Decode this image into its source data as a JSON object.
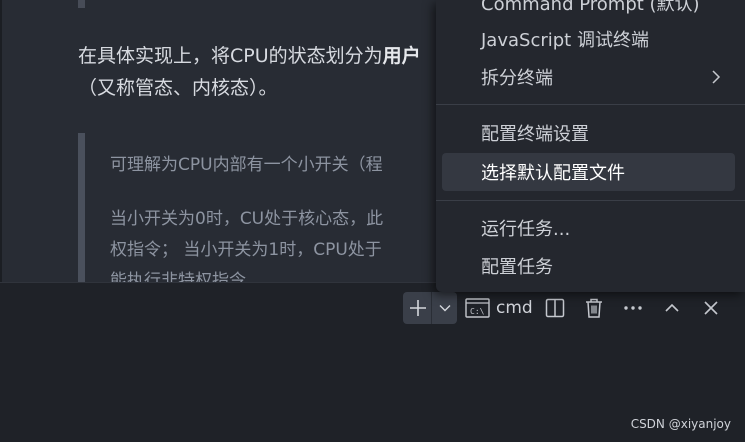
{
  "editor": {
    "para_line1_prefix": "在具体实现上，将CPU的状态划分为",
    "para_line1_bold": "用户",
    "para_line2": "（又称管态、内核态）。",
    "quote_line1": "可理解为CPU内部有一个小开关（程",
    "quote_line2": "当小开关为0时，CU处于核心态，此",
    "quote_line3": "权指令； 当小开关为1时，CPU处于",
    "quote_line4": "能执行非特权指令。"
  },
  "menu": {
    "items": [
      {
        "label": "Command Prompt (默认)"
      },
      {
        "label": "JavaScript 调试终端"
      },
      {
        "label": "拆分终端"
      },
      {
        "label": "配置终端设置"
      },
      {
        "label": "选择默认配置文件"
      },
      {
        "label": "运行任务..."
      },
      {
        "label": "配置任务"
      }
    ]
  },
  "terminal_toolbar": {
    "terminal_name": "cmd"
  },
  "watermark": "CSDN @xiyanjoy",
  "colors": {
    "panel_bg": "#1f2228",
    "menu_bg": "#24272e",
    "active_item_bg": "#343841",
    "editor_bg": "#282c34"
  }
}
